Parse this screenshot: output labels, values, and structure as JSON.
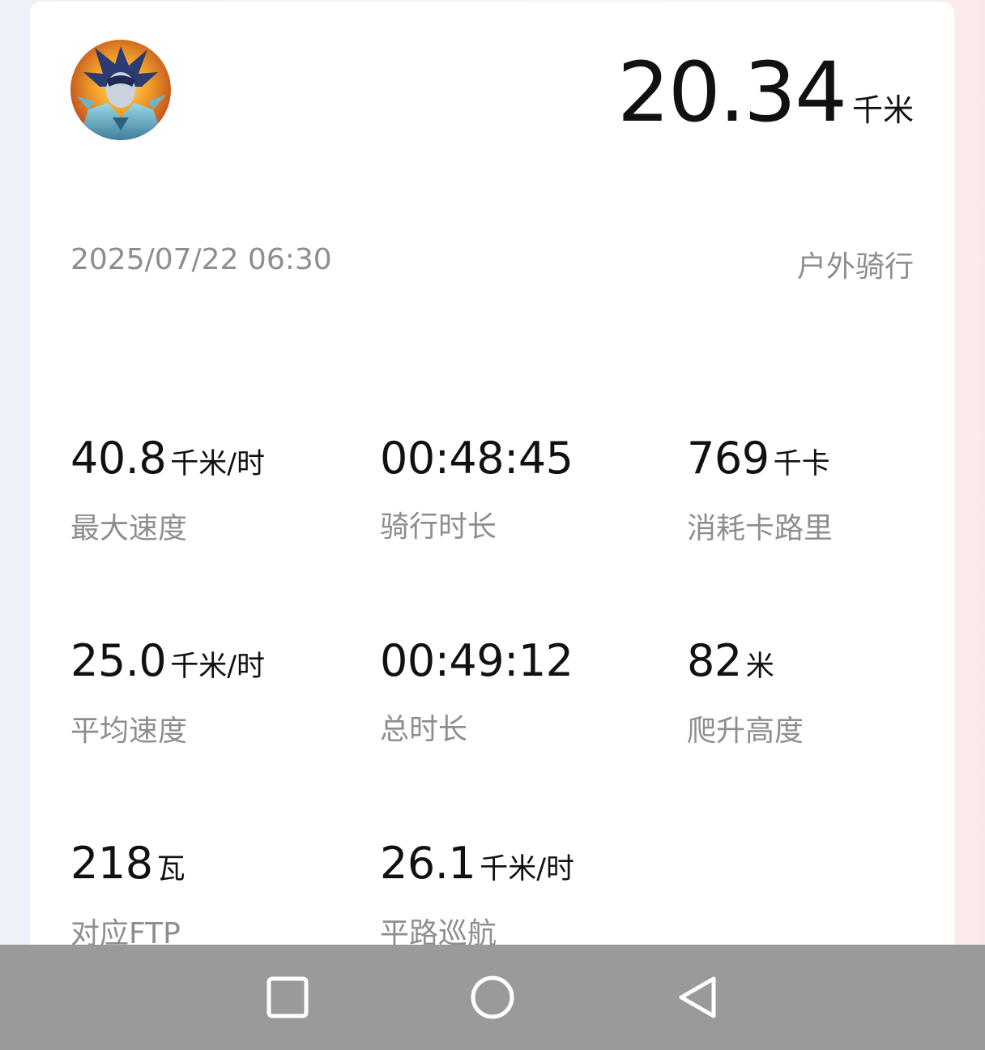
{
  "summary": {
    "distance_value": "20.34",
    "distance_unit": "千米",
    "datetime": "2025/07/22 06:30",
    "activity_type": "户外骑行"
  },
  "stats": [
    {
      "value": "40.8",
      "unit": "千米/时",
      "label": "最大速度"
    },
    {
      "value": "00:48:45",
      "unit": "",
      "label": "骑行时长"
    },
    {
      "value": "769",
      "unit": "千卡",
      "label": "消耗卡路里"
    },
    {
      "value": "25.0",
      "unit": "千米/时",
      "label": "平均速度"
    },
    {
      "value": "00:49:12",
      "unit": "",
      "label": "总时长"
    },
    {
      "value": "82",
      "unit": "米",
      "label": "爬升高度"
    },
    {
      "value": "218",
      "unit": "瓦",
      "label": "对应FTP"
    },
    {
      "value": "26.1",
      "unit": "千米/时",
      "label": "平路巡航"
    }
  ],
  "navbar": {
    "recent_icon": "square-recent-apps-icon",
    "home_icon": "circle-home-icon",
    "back_icon": "triangle-back-icon"
  },
  "colors": {
    "card_bg": "#ffffff",
    "primary_text": "#111111",
    "secondary_text": "#8e8e8e",
    "navbar_bg": "#9a9a9a",
    "navbar_icon": "#ffffff"
  }
}
